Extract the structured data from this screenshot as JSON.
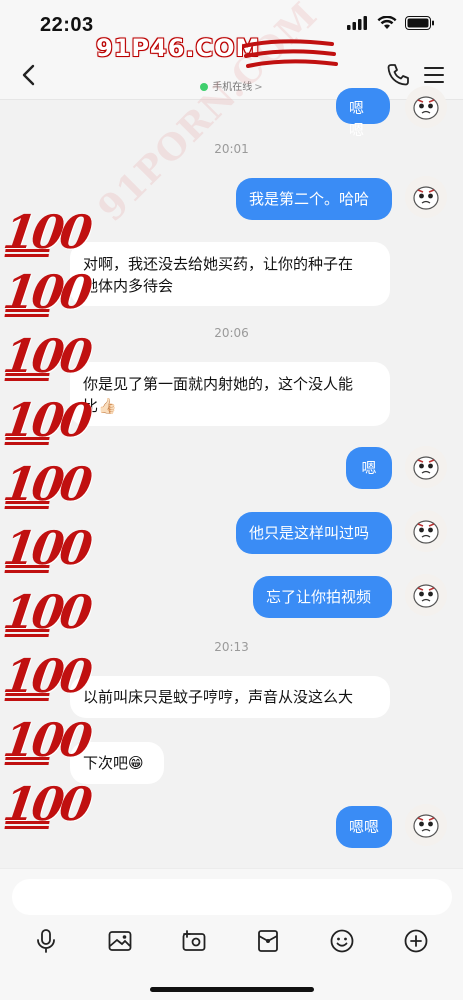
{
  "status_bar": {
    "time": "22:03"
  },
  "nav": {
    "status_text": "手机在线",
    "chevron": ">"
  },
  "messages": [
    {
      "side": "out",
      "text": "嗯嗯"
    },
    {
      "side": "time",
      "text": "20:01"
    },
    {
      "side": "out",
      "text": "我是第二个。哈哈"
    },
    {
      "side": "in",
      "line1": "对啊，我还没去给她买药，让你的种子在",
      "line2": "她体内多待会"
    },
    {
      "side": "time",
      "text": "20:06"
    },
    {
      "side": "in",
      "line1": "你是见了第一面就内射她的，这个没人能",
      "line2": "比👍🏻"
    },
    {
      "side": "out",
      "text": "嗯"
    },
    {
      "side": "out",
      "text": "他只是这样叫过吗"
    },
    {
      "side": "out",
      "text": "忘了让你拍视频"
    },
    {
      "side": "time",
      "text": "20:13"
    },
    {
      "side": "in",
      "text": "以前叫床只是蚊子哼哼，声音从没这么大"
    },
    {
      "side": "in",
      "text": "下次吧😁"
    },
    {
      "side": "out",
      "text": "嗯嗯"
    }
  ],
  "input": {
    "placeholder": ""
  },
  "toolbar": [
    "microphone-icon",
    "image-icon",
    "camera-icon",
    "red-packet-icon",
    "emoji-icon",
    "plus-icon"
  ],
  "watermarks": {
    "site": "91P46.COM",
    "site_diag": "91PORN.COM",
    "emoji": "💯"
  },
  "colors": {
    "outgoing_bubble": "#3a8cf5",
    "incoming_bubble": "#ffffff",
    "background": "#f2f2f2",
    "online_dot": "#3fcf6d",
    "watermark": "#c01010"
  }
}
